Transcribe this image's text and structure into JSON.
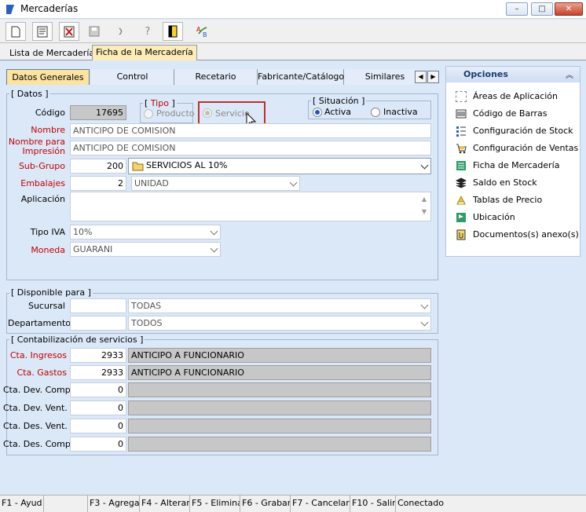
{
  "window": {
    "title": "Mercaderías",
    "min": "–",
    "max": "□",
    "close": "✕"
  },
  "toolbar": {
    "new_icon": "new-document-icon",
    "edit_icon": "edit-icon",
    "delete_icon": "delete-icon",
    "save_icon": "save-icon",
    "undo_icon": "undo-icon",
    "help_icon": "help-icon",
    "exit_icon": "exit-icon",
    "spell_icon": "spellcheck-icon",
    "help_label": "?"
  },
  "top_tabs": [
    "Lista de Mercaderías",
    "Ficha de la Mercadería"
  ],
  "sub_tabs": [
    "Datos Generales",
    "Control",
    "Recetario",
    "Fabricante/Catálogo",
    "Similares"
  ],
  "datos": {
    "group_title": "[ Datos ]",
    "codigo_label": "Código",
    "codigo": "17695",
    "tipo_title": "[ Tipo ]",
    "tipo_producto": "Producto",
    "tipo_servicio": "Servicio",
    "situacion_title": "[ Situación ]",
    "activa": "Activa",
    "inactiva": "Inactiva",
    "nombre_label": "Nombre",
    "nombre": "ANTICIPO DE COMISION",
    "impresion_label1": "Nombre para",
    "impresion_label2": "Impresión",
    "impresion": "ANTICIPO DE COMISION",
    "subgrupo_label": "Sub-Grupo",
    "subgrupo_code": "200",
    "subgrupo": "SERVICIOS AL 10%",
    "embalajes_label": "Embalajes",
    "embalajes_code": "2",
    "embalajes": "UNIDAD",
    "aplicacion_label": "Aplicación",
    "aplicacion": "",
    "tipoiva_label": "Tipo IVA",
    "tipoiva": "10%",
    "moneda_label": "Moneda",
    "moneda": "GUARANI"
  },
  "disponible": {
    "group_title": "[ Disponible para ]",
    "sucursal_label": "Sucursal",
    "sucursal": "TODAS",
    "departamento_label": "Departamento",
    "departamento": "TODOS"
  },
  "contab": {
    "group_title": "[ Contabilización de servicios ]",
    "rows": [
      {
        "label": "Cta. Ingresos",
        "code": "2933",
        "name": "ANTICIPO A FUNCIONARIO"
      },
      {
        "label": "Cta. Gastos",
        "code": "2933",
        "name": "ANTICIPO A FUNCIONARIO"
      },
      {
        "label": "Cta. Dev. Comp.",
        "code": "0",
        "name": ""
      },
      {
        "label": "Cta. Dev. Vent.",
        "code": "0",
        "name": ""
      },
      {
        "label": "Cta. Des. Vent.",
        "code": "0",
        "name": ""
      },
      {
        "label": "Cta. Des. Comp.",
        "code": "0",
        "name": ""
      }
    ]
  },
  "opciones": {
    "title": "Opciones",
    "collapse": "︽",
    "items": [
      {
        "label": "Áreas de Aplicación",
        "icon": "area-icon"
      },
      {
        "label": "Código de Barras",
        "icon": "barcode-icon"
      },
      {
        "label": "Configuración de Stock",
        "icon": "stock-config-icon"
      },
      {
        "label": "Configuración de Ventas",
        "icon": "sales-cart-icon"
      },
      {
        "label": "Ficha de Mercadería",
        "icon": "product-sheet-icon"
      },
      {
        "label": "Saldo en Stock",
        "icon": "stock-balance-icon"
      },
      {
        "label": "Tablas de Precio",
        "icon": "price-table-icon"
      },
      {
        "label": "Ubicación",
        "icon": "location-icon"
      },
      {
        "label": "Documentos(s) anexo(s)",
        "icon": "attachment-icon"
      }
    ]
  },
  "status": [
    "F1 - Ayud",
    "",
    "F3 - Agrega",
    "F4 - Alterar",
    "F5 - Elimina",
    "F6 - Grabar",
    "F7 - Cancelar",
    "F10 - Salir",
    "Conectado"
  ],
  "colors": {
    "accent_tab": "#fbe3a0",
    "panel": "#dbe8f8",
    "required": "#c00000",
    "highlight": "#c32d2d"
  }
}
